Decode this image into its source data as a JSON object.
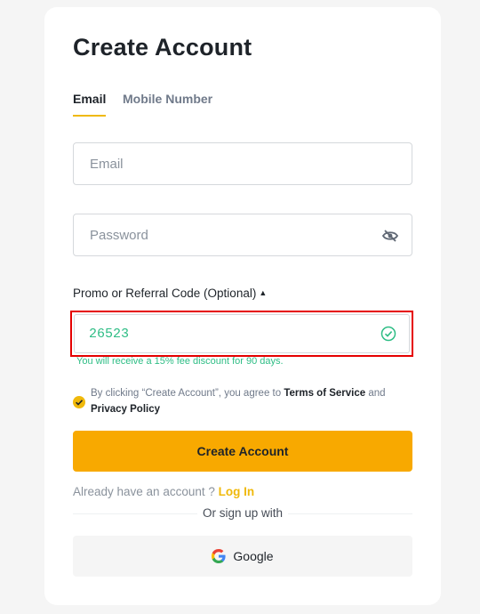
{
  "title": "Create Account",
  "tabs": [
    {
      "label": "Email",
      "active": true
    },
    {
      "label": "Mobile Number",
      "active": false
    }
  ],
  "email": {
    "placeholder": "Email",
    "value": ""
  },
  "password": {
    "placeholder": "Password",
    "value": "",
    "toggle_icon": "eye-off-icon"
  },
  "promo": {
    "label": "Promo or Referral Code (Optional)",
    "value": "26523",
    "hint": "You will receive a 15% fee discount for 90 days.",
    "status_icon": "check-circle-icon"
  },
  "agreement": {
    "checked": true,
    "prefix": "By clicking “Create Account”, you agree to ",
    "terms": "Terms of Service",
    "and": " and",
    "privacy": "Privacy Policy"
  },
  "submit_label": "Create Account",
  "login": {
    "prompt": "Already have an account ? ",
    "link": "Log In"
  },
  "or_text": "Or sign up with",
  "google_label": "Google",
  "colors": {
    "accent": "#f0b90b",
    "button": "#f8a900",
    "success": "#2ebd85",
    "highlight_border": "#e50000"
  }
}
